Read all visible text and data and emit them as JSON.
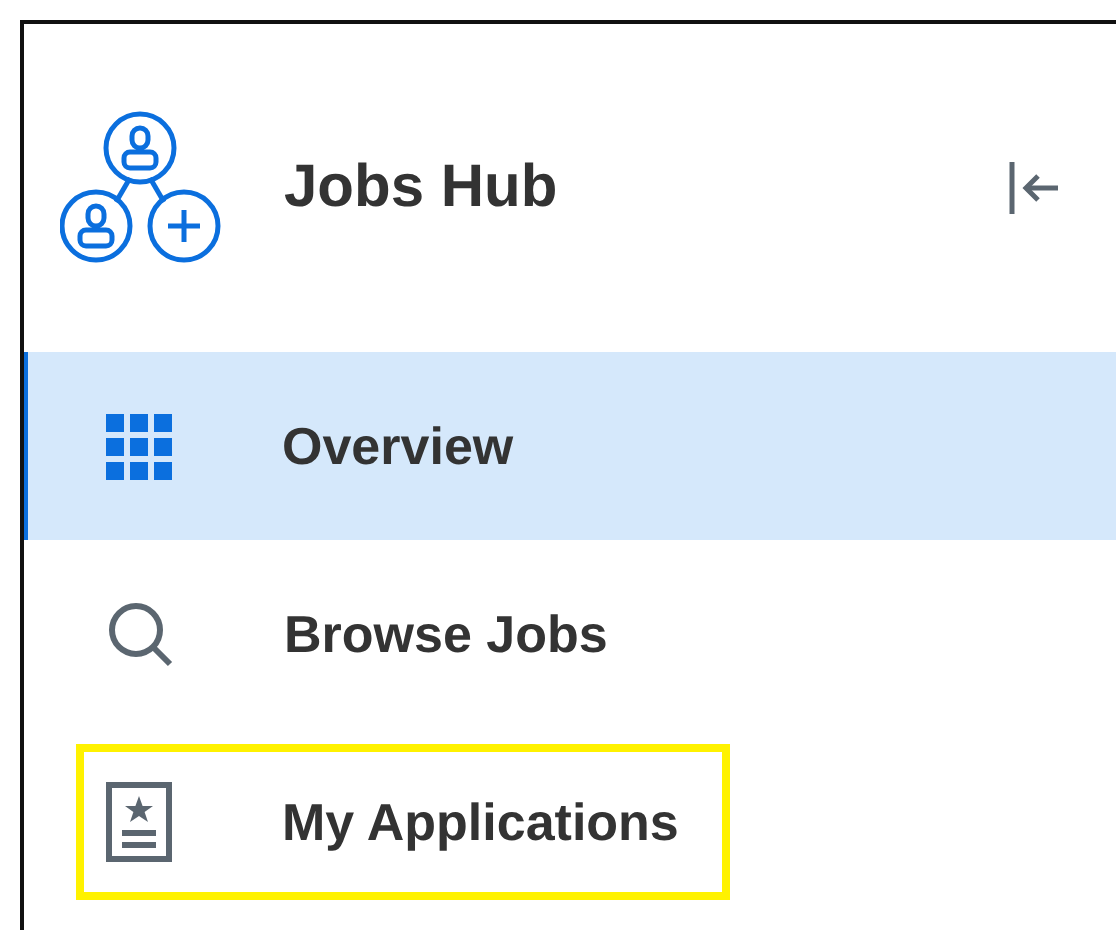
{
  "header": {
    "title": "Jobs Hub"
  },
  "nav": [
    {
      "kind": "grid",
      "label": "Overview",
      "selected": true,
      "highlighted": false
    },
    {
      "kind": "search",
      "label": "Browse Jobs",
      "selected": false,
      "highlighted": false
    },
    {
      "kind": "document",
      "label": "My Applications",
      "selected": false,
      "highlighted": true
    }
  ]
}
